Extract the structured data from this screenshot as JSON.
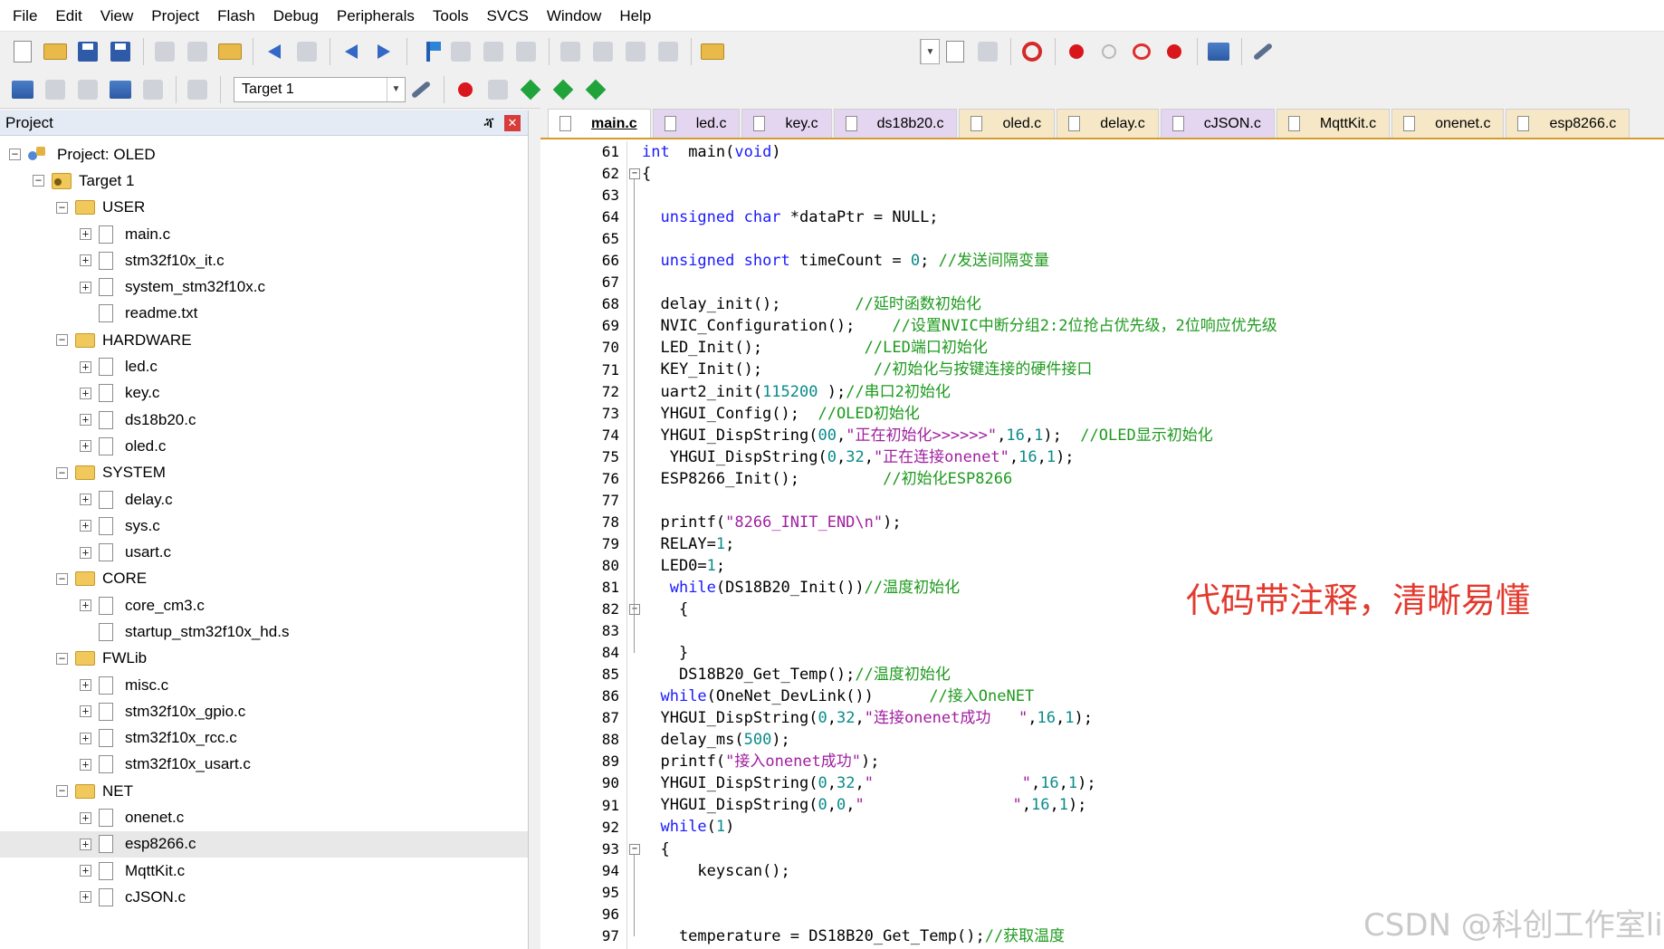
{
  "menu": [
    "File",
    "Edit",
    "View",
    "Project",
    "Flash",
    "Debug",
    "Peripherals",
    "Tools",
    "SVCS",
    "Window",
    "Help"
  ],
  "toolbar": {
    "target_name": "Target 1"
  },
  "project_panel": {
    "title": "Project",
    "pin_glyph": "ⶣ",
    "close_glyph": "✕",
    "tree": [
      {
        "label": "Project: OLED",
        "level": 0,
        "kind": "project",
        "expander": "-"
      },
      {
        "label": "Target 1",
        "level": 1,
        "kind": "target",
        "expander": "-"
      },
      {
        "label": "USER",
        "level": 2,
        "kind": "folder",
        "expander": "-"
      },
      {
        "label": "main.c",
        "level": 3,
        "kind": "file",
        "expander": "+"
      },
      {
        "label": "stm32f10x_it.c",
        "level": 3,
        "kind": "file",
        "expander": "+"
      },
      {
        "label": "system_stm32f10x.c",
        "level": 3,
        "kind": "file",
        "expander": "+"
      },
      {
        "label": "readme.txt",
        "level": 3,
        "kind": "file",
        "expander": ""
      },
      {
        "label": "HARDWARE",
        "level": 2,
        "kind": "folder",
        "expander": "-"
      },
      {
        "label": "led.c",
        "level": 3,
        "kind": "file",
        "expander": "+"
      },
      {
        "label": "key.c",
        "level": 3,
        "kind": "file",
        "expander": "+"
      },
      {
        "label": "ds18b20.c",
        "level": 3,
        "kind": "file",
        "expander": "+"
      },
      {
        "label": "oled.c",
        "level": 3,
        "kind": "file",
        "expander": "+"
      },
      {
        "label": "SYSTEM",
        "level": 2,
        "kind": "folder",
        "expander": "-"
      },
      {
        "label": "delay.c",
        "level": 3,
        "kind": "file",
        "expander": "+"
      },
      {
        "label": "sys.c",
        "level": 3,
        "kind": "file",
        "expander": "+"
      },
      {
        "label": "usart.c",
        "level": 3,
        "kind": "file",
        "expander": "+"
      },
      {
        "label": "CORE",
        "level": 2,
        "kind": "folder",
        "expander": "-"
      },
      {
        "label": "core_cm3.c",
        "level": 3,
        "kind": "file",
        "expander": "+"
      },
      {
        "label": "startup_stm32f10x_hd.s",
        "level": 3,
        "kind": "file",
        "expander": ""
      },
      {
        "label": "FWLib",
        "level": 2,
        "kind": "folder",
        "expander": "-"
      },
      {
        "label": "misc.c",
        "level": 3,
        "kind": "file",
        "expander": "+"
      },
      {
        "label": "stm32f10x_gpio.c",
        "level": 3,
        "kind": "file",
        "expander": "+"
      },
      {
        "label": "stm32f10x_rcc.c",
        "level": 3,
        "kind": "file",
        "expander": "+"
      },
      {
        "label": "stm32f10x_usart.c",
        "level": 3,
        "kind": "file",
        "expander": "+"
      },
      {
        "label": "NET",
        "level": 2,
        "kind": "folder",
        "expander": "-"
      },
      {
        "label": "onenet.c",
        "level": 3,
        "kind": "file",
        "expander": "+"
      },
      {
        "label": "esp8266.c",
        "level": 3,
        "kind": "file",
        "expander": "+",
        "selected": true
      },
      {
        "label": "MqttKit.c",
        "level": 3,
        "kind": "file",
        "expander": "+"
      },
      {
        "label": "cJSON.c",
        "level": 3,
        "kind": "file",
        "expander": "+"
      }
    ]
  },
  "tabs": [
    {
      "label": "main.c",
      "active": true,
      "style": "main"
    },
    {
      "label": "led.c",
      "style": "alt"
    },
    {
      "label": "key.c",
      "style": "alt"
    },
    {
      "label": "ds18b20.c",
      "style": "alt"
    },
    {
      "label": "oled.c",
      "style": "main"
    },
    {
      "label": "delay.c",
      "style": "main"
    },
    {
      "label": "cJSON.c",
      "style": "alt"
    },
    {
      "label": "MqttKit.c",
      "style": "main"
    },
    {
      "label": "onenet.c",
      "style": "main"
    },
    {
      "label": "esp8266.c",
      "style": "main"
    }
  ],
  "code_lines": [
    {
      "n": "61",
      "fold": "",
      "tokens": [
        [
          "kw",
          "int"
        ],
        [
          "",
          "  main("
        ],
        [
          "kw",
          "void"
        ],
        [
          "",
          ")"
        ]
      ]
    },
    {
      "n": "62",
      "fold": "box",
      "tokens": [
        [
          "",
          "{"
        ]
      ]
    },
    {
      "n": "63",
      "fold": "",
      "tokens": []
    },
    {
      "n": "64",
      "fold": "",
      "tokens": [
        [
          "",
          "  "
        ],
        [
          "kw",
          "unsigned char"
        ],
        [
          "",
          " *dataPtr = NULL;"
        ]
      ]
    },
    {
      "n": "65",
      "fold": "",
      "tokens": []
    },
    {
      "n": "66",
      "fold": "",
      "tokens": [
        [
          "",
          "  "
        ],
        [
          "kw",
          "unsigned short"
        ],
        [
          "",
          " timeCount = "
        ],
        [
          "nu",
          "0"
        ],
        [
          "",
          "; "
        ],
        [
          "cm",
          "//发送间隔变量"
        ]
      ]
    },
    {
      "n": "67",
      "fold": "",
      "tokens": []
    },
    {
      "n": "68",
      "fold": "",
      "tokens": [
        [
          "",
          "  delay_init();        "
        ],
        [
          "cm",
          "//延时函数初始化"
        ]
      ]
    },
    {
      "n": "69",
      "fold": "",
      "tokens": [
        [
          "",
          "  NVIC_Configuration();    "
        ],
        [
          "cm",
          "//设置NVIC中断分组2:2位抢占优先级，2位响应优先级"
        ]
      ]
    },
    {
      "n": "70",
      "fold": "",
      "tokens": [
        [
          "",
          "  LED_Init();           "
        ],
        [
          "cm",
          "//LED端口初始化"
        ]
      ]
    },
    {
      "n": "71",
      "fold": "",
      "tokens": [
        [
          "",
          "  KEY_Init();            "
        ],
        [
          "cm",
          "//初始化与按键连接的硬件接口"
        ]
      ]
    },
    {
      "n": "72",
      "fold": "",
      "tokens": [
        [
          "",
          "  uart2_init("
        ],
        [
          "nu",
          "115200"
        ],
        [
          "",
          " );"
        ],
        [
          "cm",
          "//串口2初始化"
        ]
      ]
    },
    {
      "n": "73",
      "fold": "",
      "tokens": [
        [
          "",
          "  YHGUI_Config();  "
        ],
        [
          "cm",
          "//OLED初始化"
        ]
      ]
    },
    {
      "n": "74",
      "fold": "",
      "tokens": [
        [
          "",
          "  YHGUI_DispString("
        ],
        [
          "nu",
          "0"
        ],
        [
          ",",
          ""
        ],
        [
          "nu",
          "0"
        ],
        [
          "",
          ","
        ],
        [
          "st",
          "\"正在初始化>>>>>>\""
        ],
        [
          "",
          ","
        ],
        [
          "nu",
          "16"
        ],
        [
          "",
          ","
        ],
        [
          "nu",
          "1"
        ],
        [
          "",
          ");  "
        ],
        [
          "cm",
          "//OLED显示初始化"
        ]
      ]
    },
    {
      "n": "75",
      "fold": "",
      "tokens": [
        [
          "",
          "   YHGUI_DispString("
        ],
        [
          "nu",
          "0"
        ],
        [
          "",
          ","
        ],
        [
          "nu",
          "32"
        ],
        [
          "",
          ","
        ],
        [
          "st",
          "\"正在连接onenet\""
        ],
        [
          "",
          ","
        ],
        [
          "nu",
          "16"
        ],
        [
          "",
          ","
        ],
        [
          "nu",
          "1"
        ],
        [
          "",
          ");"
        ]
      ]
    },
    {
      "n": "76",
      "fold": "",
      "tokens": [
        [
          "",
          "  ESP8266_Init();         "
        ],
        [
          "cm",
          "//初始化ESP8266"
        ]
      ]
    },
    {
      "n": "77",
      "fold": "",
      "tokens": []
    },
    {
      "n": "78",
      "fold": "",
      "tokens": [
        [
          "",
          "  printf("
        ],
        [
          "st",
          "\"8266_INIT_END\\n\""
        ],
        [
          "",
          ");"
        ]
      ]
    },
    {
      "n": "79",
      "fold": "",
      "tokens": [
        [
          "",
          "  RELAY="
        ],
        [
          "nu",
          "1"
        ],
        [
          "",
          ";"
        ]
      ]
    },
    {
      "n": "80",
      "fold": "",
      "tokens": [
        [
          "",
          "  LED0="
        ],
        [
          "nu",
          "1"
        ],
        [
          "",
          ";"
        ]
      ]
    },
    {
      "n": "81",
      "fold": "",
      "tokens": [
        [
          "",
          "   "
        ],
        [
          "kw",
          "while"
        ],
        [
          "",
          "(DS18B20_Init())"
        ],
        [
          "cm",
          "//温度初始化"
        ]
      ]
    },
    {
      "n": "82",
      "fold": "box",
      "tokens": [
        [
          "",
          "    {"
        ]
      ]
    },
    {
      "n": "83",
      "fold": "",
      "tokens": []
    },
    {
      "n": "84",
      "fold": "end",
      "tokens": [
        [
          "",
          "    }"
        ]
      ]
    },
    {
      "n": "85",
      "fold": "",
      "tokens": [
        [
          "",
          "    DS18B20_Get_Temp();"
        ],
        [
          "cm",
          "//温度初始化"
        ]
      ]
    },
    {
      "n": "86",
      "fold": "",
      "tokens": [
        [
          "",
          "  "
        ],
        [
          "kw",
          "while"
        ],
        [
          "",
          "(OneNet_DevLink())      "
        ],
        [
          "cm",
          "//接入OneNET"
        ]
      ]
    },
    {
      "n": "87",
      "fold": "",
      "tokens": [
        [
          "",
          "  YHGUI_DispString("
        ],
        [
          "nu",
          "0"
        ],
        [
          "",
          ","
        ],
        [
          "nu",
          "32"
        ],
        [
          "",
          ","
        ],
        [
          "st",
          "\"连接onenet成功   \""
        ],
        [
          "",
          ","
        ],
        [
          "nu",
          "16"
        ],
        [
          "",
          ","
        ],
        [
          "nu",
          "1"
        ],
        [
          "",
          ");"
        ]
      ]
    },
    {
      "n": "88",
      "fold": "",
      "tokens": [
        [
          "",
          "  delay_ms("
        ],
        [
          "nu",
          "500"
        ],
        [
          "",
          ");"
        ]
      ]
    },
    {
      "n": "89",
      "fold": "",
      "tokens": [
        [
          "",
          "  printf("
        ],
        [
          "st",
          "\"接入onenet成功\""
        ],
        [
          "",
          ");"
        ]
      ]
    },
    {
      "n": "90",
      "fold": "",
      "tokens": [
        [
          "",
          "  YHGUI_DispString("
        ],
        [
          "nu",
          "0"
        ],
        [
          "",
          ","
        ],
        [
          "nu",
          "32"
        ],
        [
          "",
          ","
        ],
        [
          "st",
          "\"                \""
        ],
        [
          "",
          ","
        ],
        [
          "nu",
          "16"
        ],
        [
          "",
          ","
        ],
        [
          "nu",
          "1"
        ],
        [
          "",
          ");"
        ]
      ]
    },
    {
      "n": "91",
      "fold": "",
      "tokens": [
        [
          "",
          "  YHGUI_DispString("
        ],
        [
          "nu",
          "0"
        ],
        [
          "",
          ","
        ],
        [
          "nu",
          "0"
        ],
        [
          "",
          ","
        ],
        [
          "st",
          "\"                \""
        ],
        [
          "",
          ","
        ],
        [
          "nu",
          "16"
        ],
        [
          "",
          ","
        ],
        [
          "nu",
          "1"
        ],
        [
          "",
          ");"
        ]
      ]
    },
    {
      "n": "92",
      "fold": "",
      "tokens": [
        [
          "",
          "  "
        ],
        [
          "kw",
          "while"
        ],
        [
          "",
          "("
        ],
        [
          "nu",
          "1"
        ],
        [
          "",
          ")"
        ]
      ]
    },
    {
      "n": "93",
      "fold": "box",
      "tokens": [
        [
          "",
          "  {"
        ]
      ]
    },
    {
      "n": "94",
      "fold": "",
      "tokens": [
        [
          "",
          "      keyscan();"
        ]
      ]
    },
    {
      "n": "95",
      "fold": "",
      "tokens": []
    },
    {
      "n": "96",
      "fold": "",
      "tokens": []
    },
    {
      "n": "97",
      "fold": "",
      "tokens": [
        [
          "",
          "    temperature = DS18B20_Get_Temp();"
        ],
        [
          "cm",
          "//获取温度"
        ]
      ]
    }
  ],
  "annotation": "代码带注释，清晰易懂",
  "watermark": "CSDN @科创工作室li"
}
